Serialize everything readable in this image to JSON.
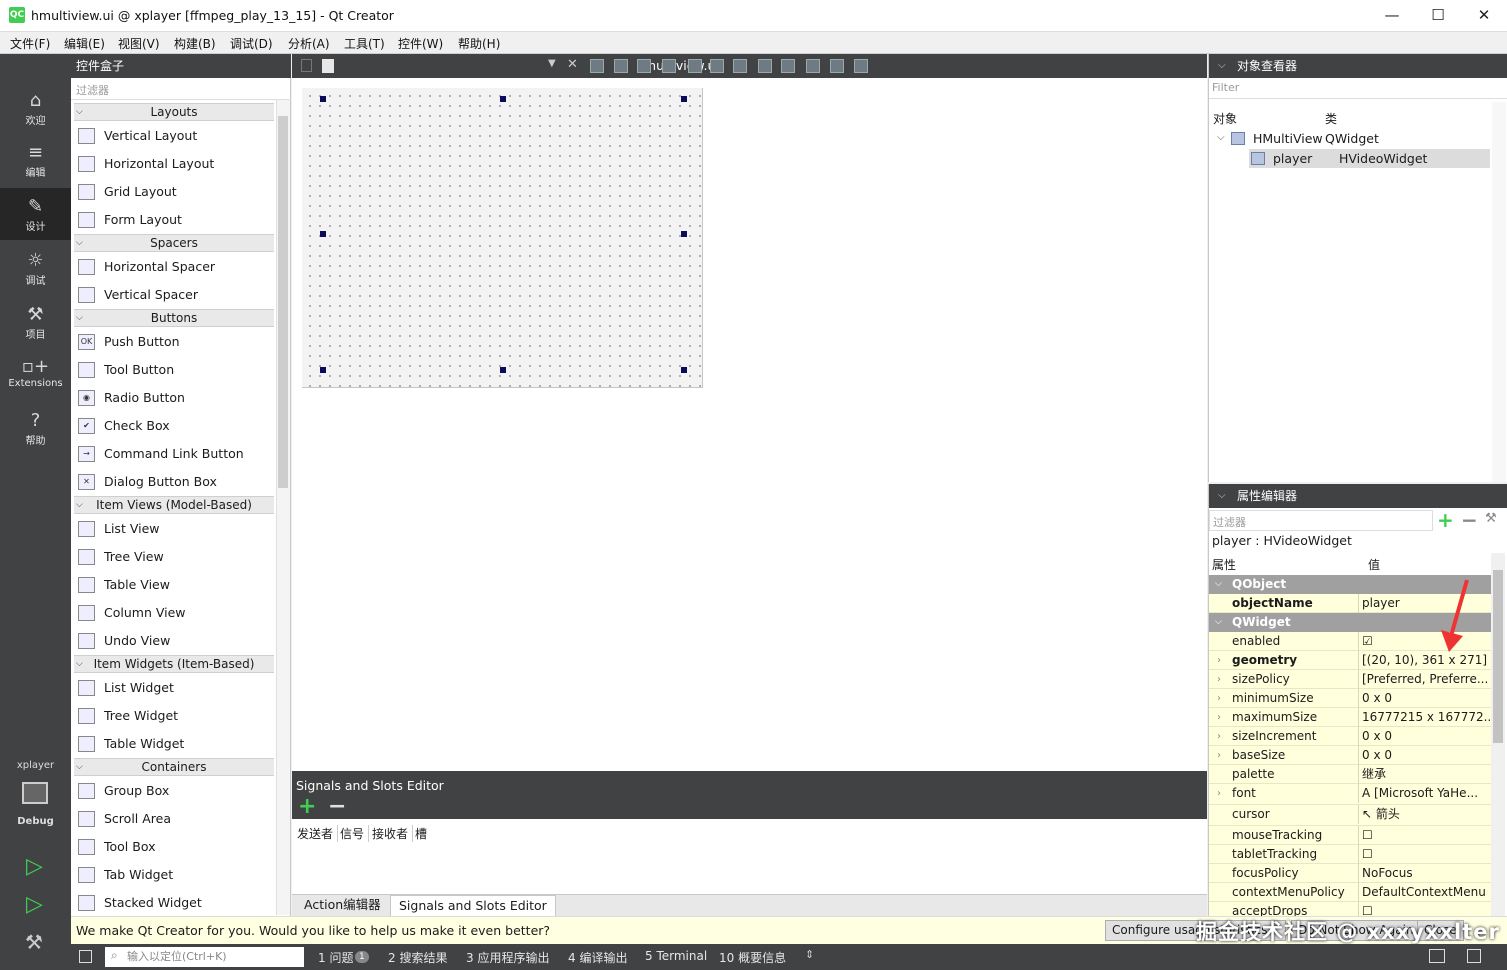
{
  "window": {
    "title": "hmultiview.ui @ xplayer [ffmpeg_play_13_15] - Qt Creator",
    "app_icon": "QC",
    "min": "—",
    "max": "☐",
    "close": "✕"
  },
  "menu": [
    "文件(F)",
    "编辑(E)",
    "视图(V)",
    "构建(B)",
    "调试(D)",
    "分析(A)",
    "工具(T)",
    "控件(W)",
    "帮助(H)"
  ],
  "modes": [
    {
      "label": "欢迎",
      "icon": "home-icon",
      "glyph": "⌂"
    },
    {
      "label": "编辑",
      "icon": "edit-lines-icon",
      "glyph": "≡"
    },
    {
      "label": "设计",
      "icon": "pen-icon",
      "glyph": "✎"
    },
    {
      "label": "调试",
      "icon": "bug-icon",
      "glyph": "☼"
    },
    {
      "label": "项目",
      "icon": "wrench-icon",
      "glyph": "⚒"
    },
    {
      "label": "Extensions",
      "icon": "extensions-icon",
      "glyph": "▫+"
    },
    {
      "label": "帮助",
      "icon": "help-icon",
      "glyph": "?"
    }
  ],
  "kit": {
    "project": "xplayer",
    "config": "Debug"
  },
  "toolbox": {
    "title": "控件盒子",
    "filter_placeholder": "过滤器",
    "categories": [
      {
        "name": "Layouts",
        "items": [
          "Vertical Layout",
          "Horizontal Layout",
          "Grid Layout",
          "Form Layout"
        ]
      },
      {
        "name": "Spacers",
        "items": [
          "Horizontal Spacer",
          "Vertical Spacer"
        ]
      },
      {
        "name": "Buttons",
        "items": [
          "Push Button",
          "Tool Button",
          "Radio Button",
          "Check Box",
          "Command Link Button",
          "Dialog Button Box"
        ]
      },
      {
        "name": "Item Views (Model-Based)",
        "items": [
          "List View",
          "Tree View",
          "Table View",
          "Column View",
          "Undo View"
        ]
      },
      {
        "name": "Item Widgets (Item-Based)",
        "items": [
          "List Widget",
          "Tree Widget",
          "Table Widget"
        ]
      },
      {
        "name": "Containers",
        "items": [
          "Group Box",
          "Scroll Area",
          "Tool Box",
          "Tab Widget",
          "Stacked Widget"
        ]
      }
    ]
  },
  "editor": {
    "file": "hmultiview.ui",
    "close": "✕"
  },
  "signals": {
    "title": "Signals and Slots Editor",
    "columns": [
      "发送者",
      "信号",
      "接收者",
      "槽"
    ]
  },
  "editor_tabs": [
    "Action编辑器",
    "Signals and Slots Editor"
  ],
  "object_inspector": {
    "title": "对象查看器",
    "filter_placeholder": "Filter",
    "col_object": "对象",
    "col_class": "类",
    "rows": [
      {
        "object": "HMultiView",
        "class": "QWidget"
      },
      {
        "object": "player",
        "class": "HVideoWidget"
      }
    ]
  },
  "property_editor": {
    "title": "属性编辑器",
    "filter_placeholder": "过滤器",
    "context": "player : HVideoWidget",
    "col_property": "属性",
    "col_value": "值",
    "rows": [
      {
        "kind": "group",
        "name": "QObject"
      },
      {
        "kind": "prop",
        "name": "objectName",
        "value": "player",
        "bold": true
      },
      {
        "kind": "group",
        "name": "QWidget"
      },
      {
        "kind": "prop",
        "name": "enabled",
        "value": "☑"
      },
      {
        "kind": "prop",
        "name": "geometry",
        "value": "[(20, 10), 361 x 271]",
        "bold": true,
        "expand": true
      },
      {
        "kind": "prop",
        "name": "sizePolicy",
        "value": "[Preferred, Preferre...",
        "expand": true
      },
      {
        "kind": "prop",
        "name": "minimumSize",
        "value": "0 x 0",
        "expand": true
      },
      {
        "kind": "prop",
        "name": "maximumSize",
        "value": "16777215 x 167772...",
        "expand": true
      },
      {
        "kind": "prop",
        "name": "sizeIncrement",
        "value": "0 x 0",
        "expand": true
      },
      {
        "kind": "prop",
        "name": "baseSize",
        "value": "0 x 0",
        "expand": true
      },
      {
        "kind": "prop",
        "name": "palette",
        "value": "继承"
      },
      {
        "kind": "prop",
        "name": "font",
        "value": "A  [Microsoft YaHe...",
        "expand": true
      },
      {
        "kind": "prop",
        "name": "cursor",
        "value": "↖  箭头"
      },
      {
        "kind": "prop",
        "name": "mouseTracking",
        "value": "☐"
      },
      {
        "kind": "prop",
        "name": "tabletTracking",
        "value": "☐"
      },
      {
        "kind": "prop",
        "name": "focusPolicy",
        "value": "NoFocus"
      },
      {
        "kind": "prop",
        "name": "contextMenuPolicy",
        "value": "DefaultContextMenu"
      },
      {
        "kind": "prop",
        "name": "acceptDrops",
        "value": "☐"
      }
    ]
  },
  "infobar": {
    "message": "We make Qt Creator for you. Would you like to help us make it even better?",
    "configure": "Configure usage statistics...",
    "dont_show": "Do Not Show Again",
    "close": "Close"
  },
  "watermark": "掘金技术社区 @ xxxyxxlter",
  "statusbar": {
    "locate_placeholder": "输入以定位(Ctrl+K)",
    "tabs": [
      "1  问题",
      "2  搜索结果",
      "3  应用程序输出",
      "4  编译输出",
      "5  Terminal",
      "10  概要信息"
    ],
    "issues_badge": "1"
  },
  "colors": {
    "dark": "#404244",
    "accent_green": "#41cd52",
    "prop_bg": "#ffffdc",
    "group_bg": "#a0a0a0",
    "annotation_arrow": "#ee3333"
  }
}
